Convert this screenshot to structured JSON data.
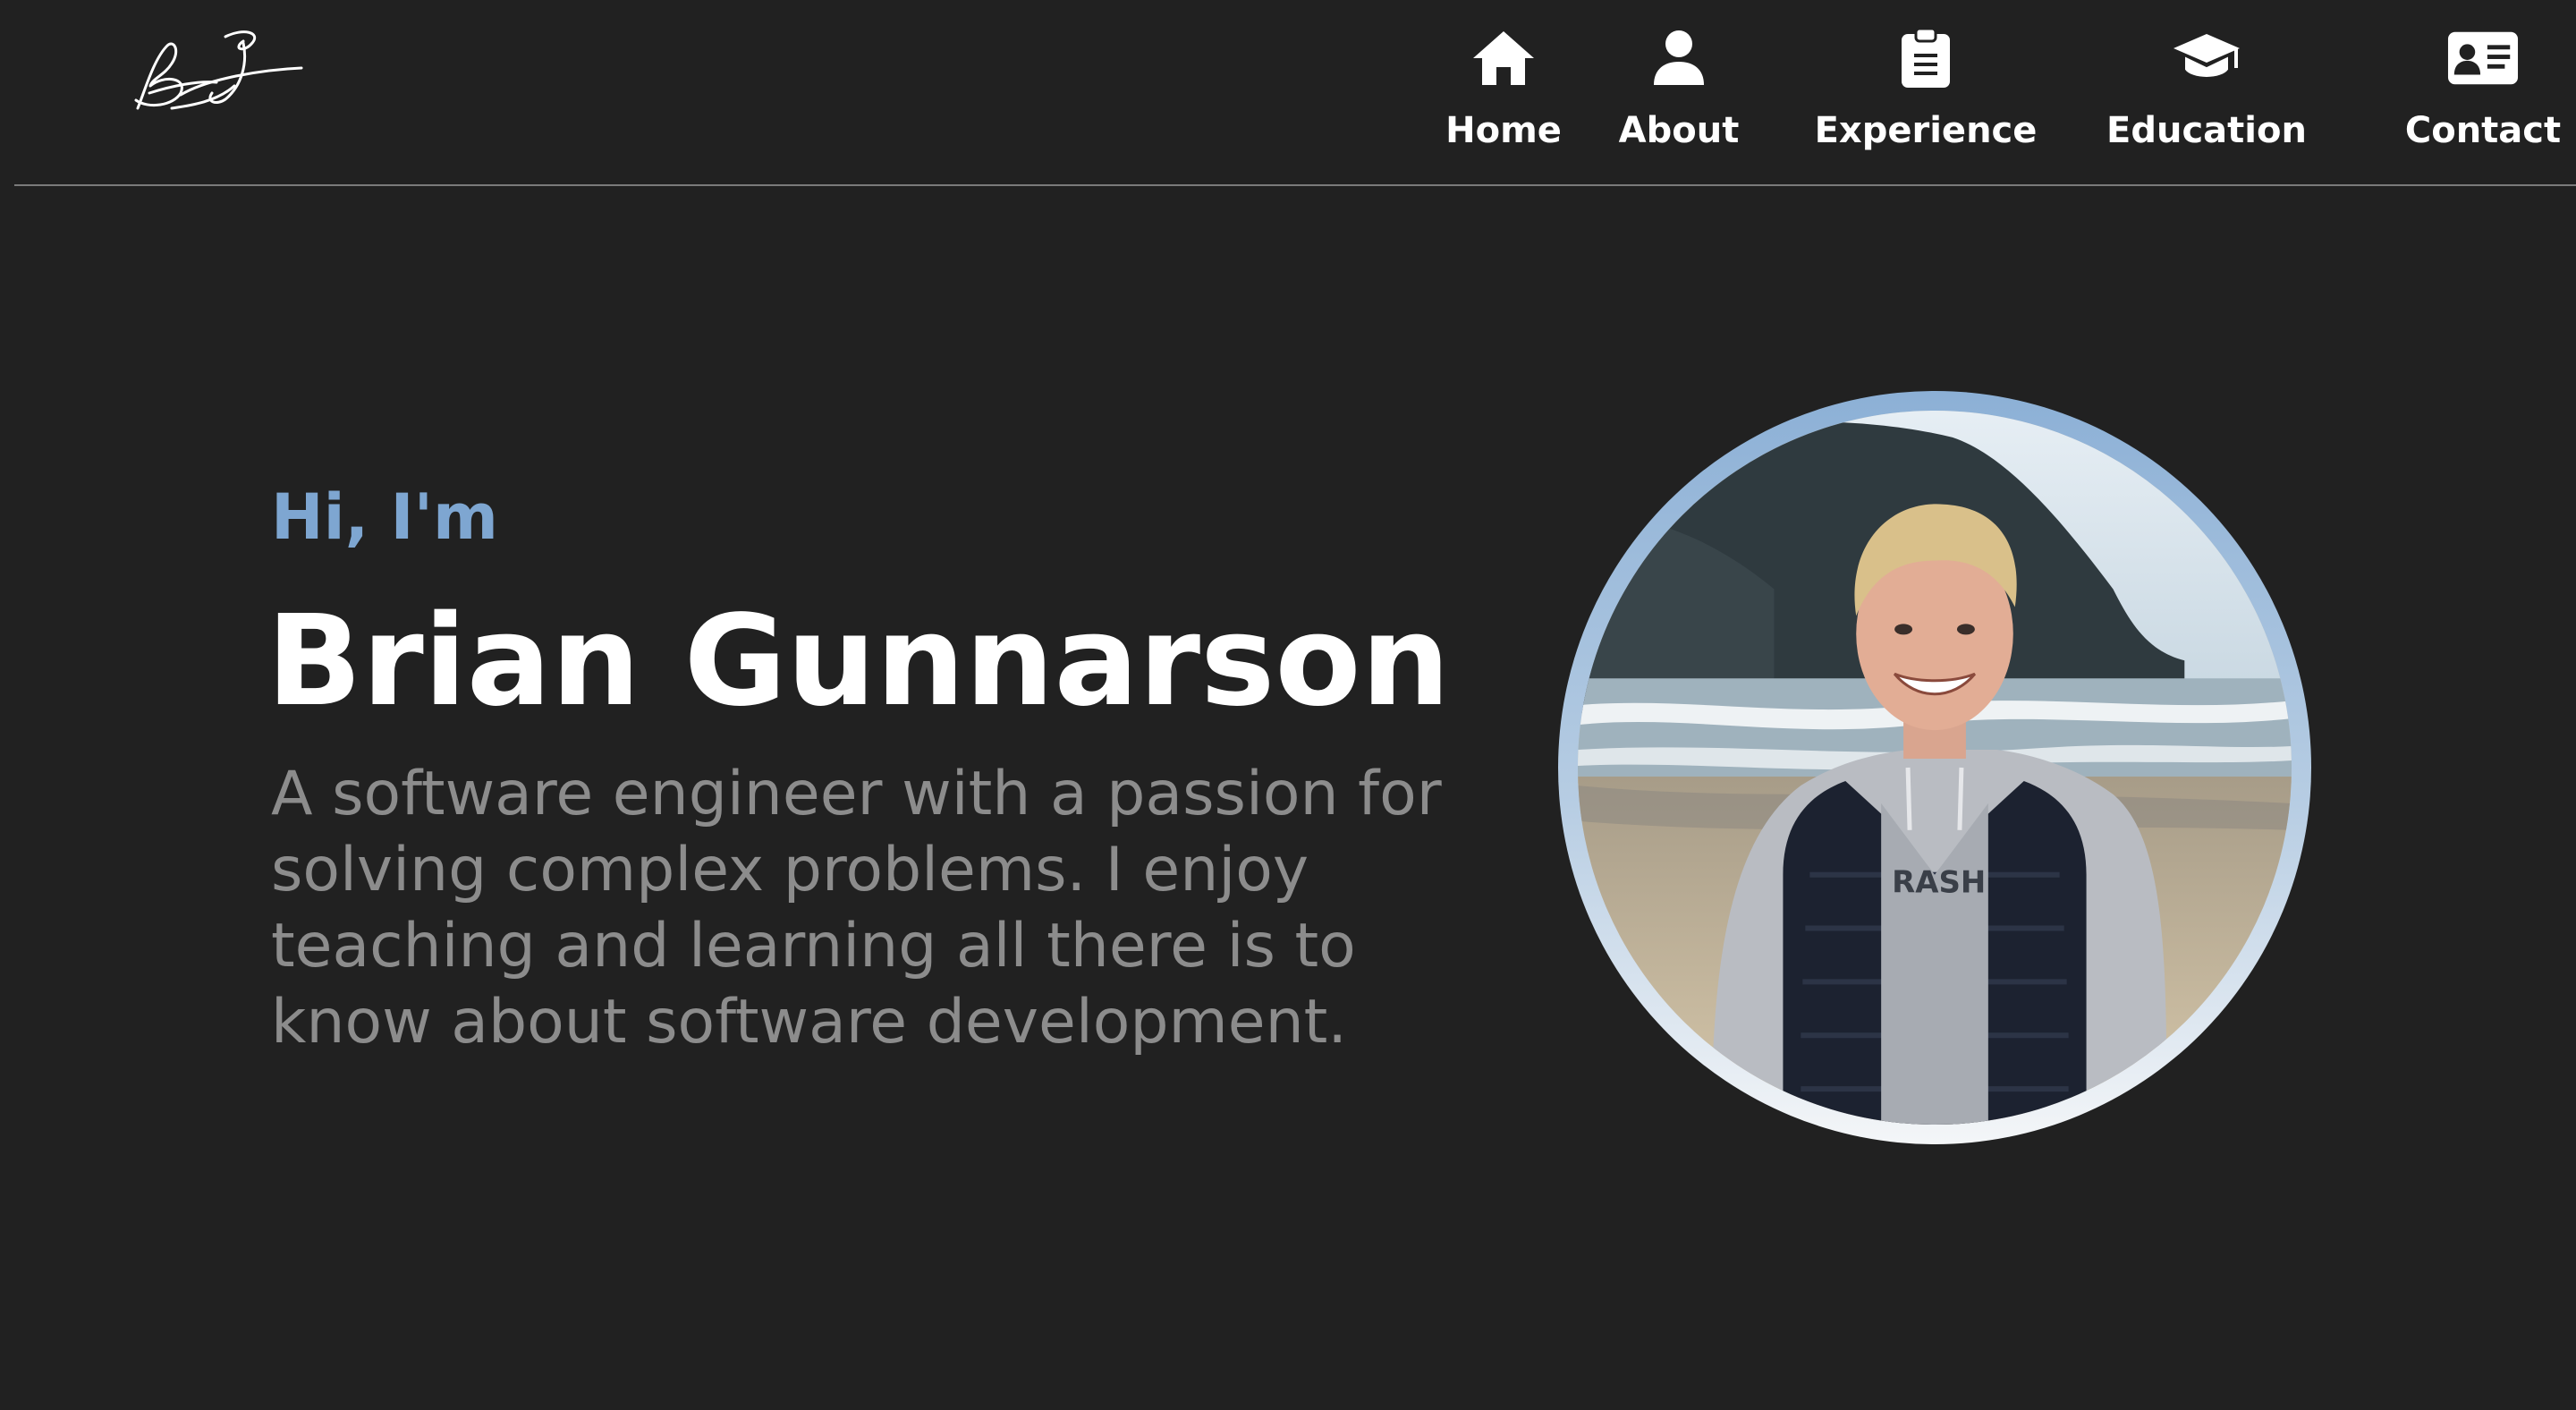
{
  "header": {
    "logo_alt": "BG",
    "nav": [
      {
        "label": "Home",
        "icon": "home-icon"
      },
      {
        "label": "About",
        "icon": "person-icon"
      },
      {
        "label": "Experience",
        "icon": "clipboard-icon"
      },
      {
        "label": "Education",
        "icon": "graduation-cap-icon"
      },
      {
        "label": "Contact",
        "icon": "contact-card-icon"
      }
    ]
  },
  "hero": {
    "greeting": "Hi, I'm",
    "name": "Brian Gunnarson",
    "bio": "A software engineer with a passion for solving complex problems. I enjoy teaching and learning all there is to know about software development."
  },
  "colors": {
    "background": "#212121",
    "accent": "#7ea6d1",
    "text": "#ffffff",
    "muted": "#8c8c8c"
  }
}
